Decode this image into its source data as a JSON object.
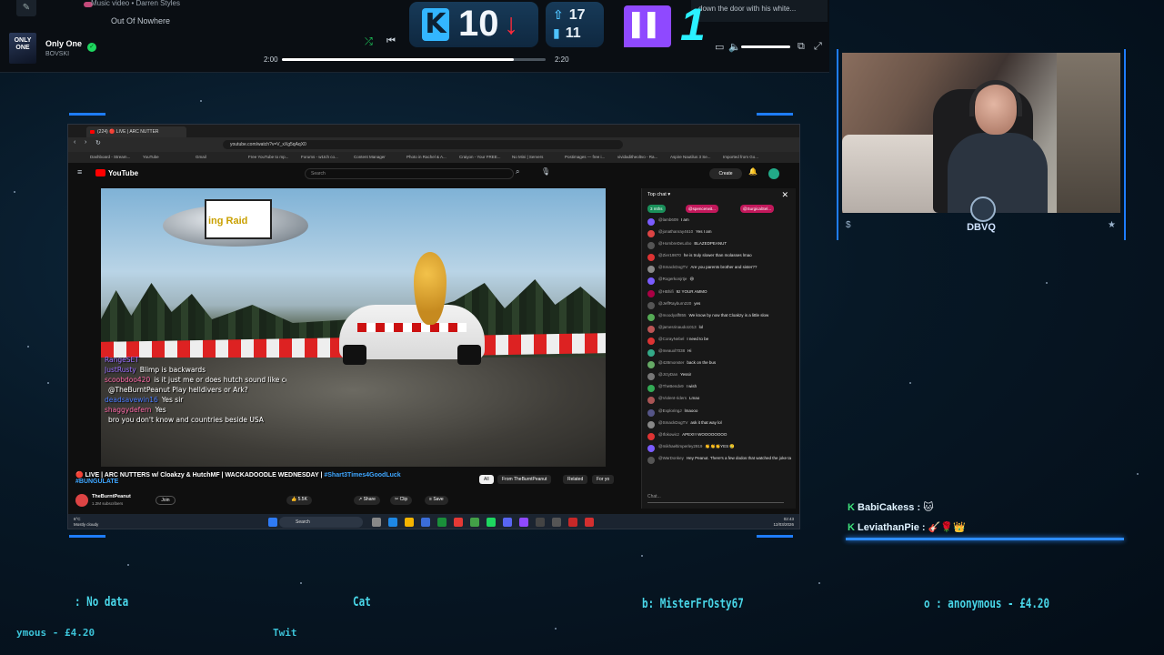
{
  "music": {
    "queue_line1": "Music video • Darren Styles",
    "queue_line2": "Out Of Nowhere",
    "album_art_text": "ONLY ONE",
    "track_title": "Only One",
    "track_artist": "BOVSKI",
    "time_elapsed": "2:00",
    "time_total": "2:20",
    "progress_fraction": 0.88,
    "lyric_snippet": "down the door with his white..."
  },
  "counters": {
    "kill_letter": "K",
    "kill_value": "10",
    "kill_arrow": "↓",
    "stat_up": "17",
    "stat_bars": "11",
    "twitch_value": "1"
  },
  "browser": {
    "tab_title": "(224) 🔴 LIVE | ARC NUTTER",
    "url": "youtube.com/watch?v=V_xXg5qAqX0",
    "bookmarks": [
      "Dashboard - Stream...",
      "YouTube",
      "Gmail",
      "Free YouTube to mp...",
      "Forums - w1tch co...",
      "Content Manager",
      "Photo in Rachel & A...",
      "Craiyon - Your FREE...",
      "No Mini | Servers",
      "Postimages — free i...",
      "vividaditheoltvo - Ra...",
      "Aspire Nautilus 3 Se...",
      "Imported from Go..."
    ],
    "yt_logo": "YouTube",
    "yt_search_placeholder": "Search",
    "yt_create": "Create",
    "video": {
      "blimp_text": "ing Raid",
      "overlay_chat": [
        {
          "name": "RangeSET",
          "text": ""
        },
        {
          "name": "JustRusty",
          "text": "Blimp is backwards"
        },
        {
          "name": "scoobdoo420",
          "text": "is it just me or does hutch sound like courage"
        },
        {
          "name": "",
          "text": "@TheBurntPeanut Play helldivers or Ark?"
        },
        {
          "name": "deadsavewin16",
          "text": "Yes sir"
        },
        {
          "name": "shaggydefern",
          "text": "Yes"
        },
        {
          "name": "",
          "text": "bro you don't know and countries beside USA"
        }
      ]
    },
    "title_main": "🔴 LIVE | ARC NUTTERS w/ Cloakzy & HutchMF | WACKADOODLE WEDNESDAY |",
    "title_tag1": "#Shart3Times4GoodLuck",
    "title_tag2": "#BUNGULATE",
    "chips": [
      "All",
      "From TheBurntPeanut",
      "Related",
      "For yo"
    ],
    "channel_name": "TheBurntPeanut",
    "channel_subs": "1.2M subscribers",
    "join": "Join",
    "likes": "5.5K",
    "share": "Share",
    "clip": "Clip",
    "save": "Save",
    "chat_header": "Top chat",
    "pinned": [
      "3 mths",
      "@spencerwit...",
      "@SurgicalSel..."
    ],
    "chat_messages": [
      {
        "user": "@lamb609",
        "text": "I am",
        "color": "#7a5cff"
      },
      {
        "user": "@jonathanray4610",
        "text": "Yes I am",
        "color": "#d44"
      },
      {
        "user": "@HombreDeLobo",
        "text": "BLAZEDPEANUT",
        "color": "#555"
      },
      {
        "user": "@Zier19870",
        "text": "he is truly slower than molasses lmao",
        "color": "#d33"
      },
      {
        "user": "@SmackDogTV",
        "text": "Are you parents brother and sister??",
        "color": "#888"
      },
      {
        "user": "@Rogerkonjrtje",
        "text": "😆",
        "color": "#7a5cff"
      },
      {
        "user": "@HBhifi",
        "text": "9z YOUR AMMO",
        "color": "#a04"
      },
      {
        "user": "@JeffRayburn220",
        "text": "yes",
        "color": "#555"
      },
      {
        "user": "@moodyaff855",
        "text": "We know by now that Cloakzy is a little slow",
        "color": "#5a5"
      },
      {
        "user": "@jamesrinaudo1013",
        "text": "lol",
        "color": "#b55"
      },
      {
        "user": "@CorayNebel",
        "text": "I need to be",
        "color": "#d33"
      },
      {
        "user": "@meauxl7038",
        "text": "Hi",
        "color": "#3a8"
      },
      {
        "user": "@428monster",
        "text": "back on the bus",
        "color": "#6a6"
      },
      {
        "user": "@JrzyDan",
        "text": "Yessir",
        "color": "#777"
      },
      {
        "user": "@TheBendv9",
        "text": "I wish",
        "color": "#3a5"
      },
      {
        "user": "@Violent-riders",
        "text": "Lmao",
        "color": "#a55"
      },
      {
        "user": "@ExploringJ",
        "text": "lmaooo",
        "color": "#558"
      },
      {
        "user": "@SmackDogTV",
        "text": "ask it that way lol",
        "color": "#888"
      },
      {
        "user": "@Ifokowicz",
        "text": "APEX!!! WOOOOOOOO",
        "color": "#d33"
      },
      {
        "user": "@mikhaeltimperley2919",
        "text": "👏👏👏YES 🥲",
        "color": "#7a5cff"
      },
      {
        "user": "@WarDonkey",
        "text": "Hey Peanut. There's a few dodos that watched the joke take off without them in chat",
        "color": "#555"
      }
    ],
    "chat_input_placeholder": "Chat...",
    "taskbar_search": "Search",
    "weather_temp": "6°C",
    "weather_desc": "Mostly cloudy",
    "clock_time": "02:43",
    "clock_date": "12/03/2026"
  },
  "webcam": {
    "logo_text": "DBVQ",
    "side_left": "$",
    "side_right": "★"
  },
  "recent": [
    {
      "icon": "K",
      "name": "BabiCakess :"
    },
    {
      "icon": "K",
      "name": "LeviathanPie :"
    }
  ],
  "tickers": {
    "t1": ": No data",
    "t2": "Cat",
    "t3": "b: MisterFrOsty67",
    "t4": "o : anonymous - £4.20",
    "t5": "ymous - £4.20",
    "t6": "Twit"
  }
}
